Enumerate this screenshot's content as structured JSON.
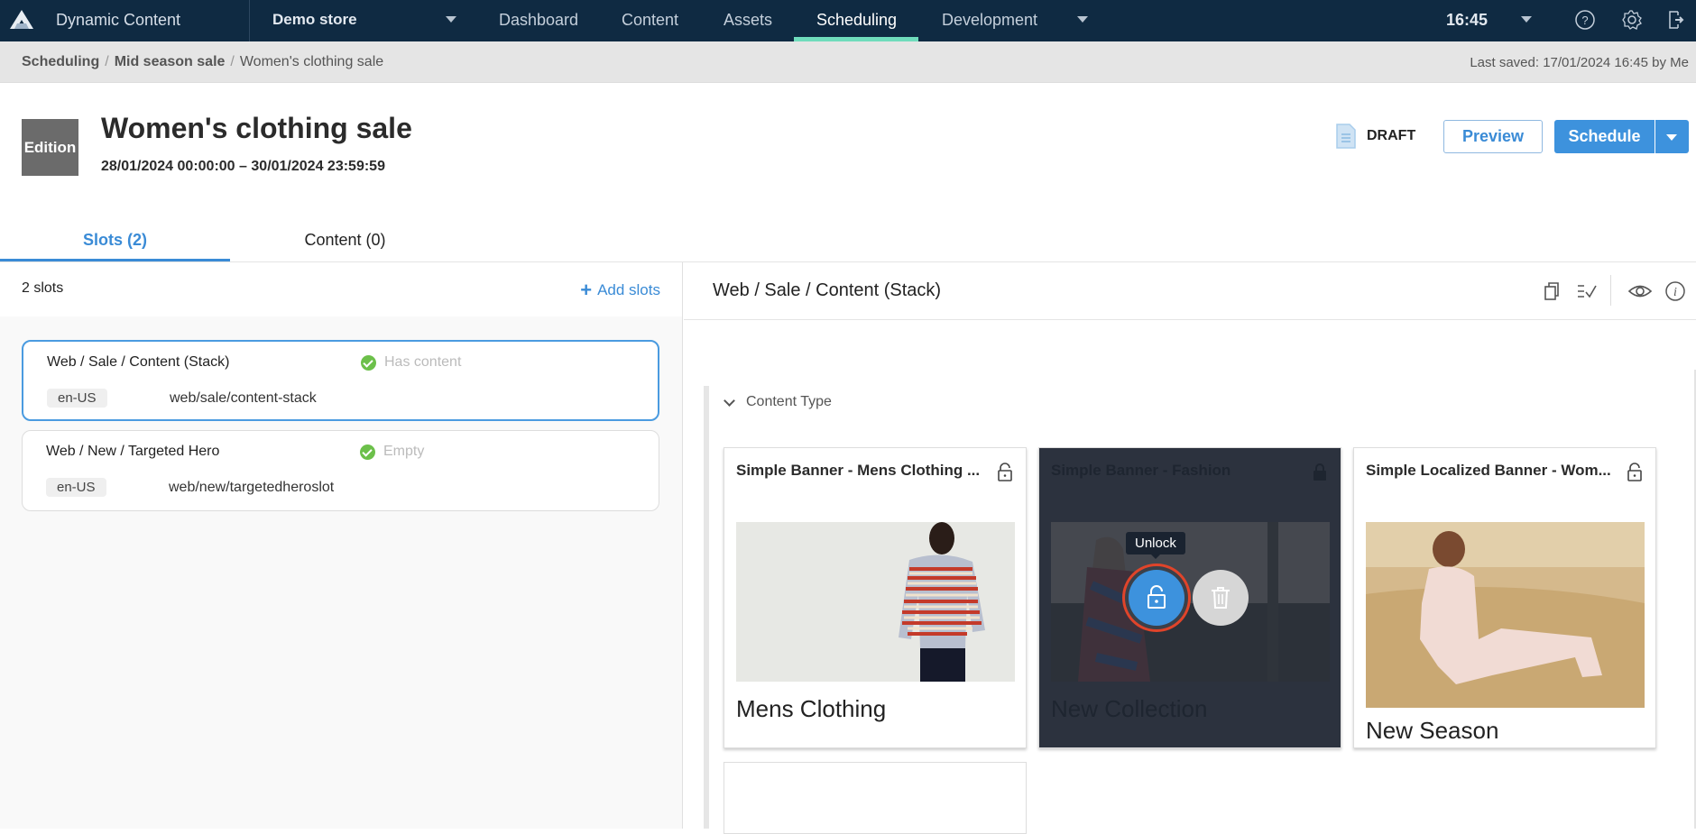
{
  "topbar": {
    "app_title": "Dynamic Content",
    "store": "Demo store",
    "nav": [
      {
        "label": "Dashboard",
        "active": false
      },
      {
        "label": "Content",
        "active": false
      },
      {
        "label": "Assets",
        "active": false
      },
      {
        "label": "Scheduling",
        "active": true
      },
      {
        "label": "Development",
        "active": false
      }
    ],
    "clock": "16:45",
    "icons": [
      "help-icon",
      "settings-icon",
      "logout-icon"
    ],
    "accent_color": "#6fdcbc"
  },
  "breadcrumb": {
    "items": [
      "Scheduling",
      "Mid season sale",
      "Women's clothing sale"
    ],
    "last_saved": "Last saved: 17/01/2024 16:45 by Me"
  },
  "header": {
    "badge": "Edition",
    "title": "Women's clothing sale",
    "date_start": "28/01/2024 00:00:00",
    "date_sep": "–",
    "date_end": "30/01/2024 23:59:59",
    "status": "DRAFT",
    "preview_label": "Preview",
    "schedule_label": "Schedule",
    "primary_color": "#3d92dd"
  },
  "tabs": [
    {
      "label": "Slots (2)",
      "active": true
    },
    {
      "label": "Content (0)",
      "active": false
    }
  ],
  "slots_panel": {
    "count_label": "2 slots",
    "add_label": "Add slots",
    "slots": [
      {
        "name": "Web / Sale / Content (Stack)",
        "status": "Has content",
        "locale": "en-US",
        "key": "web/sale/content-stack",
        "selected": true
      },
      {
        "name": "Web / New / Targeted Hero",
        "status": "Empty",
        "locale": "en-US",
        "key": "web/new/targetedheroslot",
        "selected": false
      }
    ]
  },
  "editor": {
    "title": "Web / Sale / Content (Stack)",
    "toolbar_icons": [
      "copy-icon",
      "validate-icon",
      "preview-icon",
      "info-icon"
    ],
    "section_label": "Content Type",
    "cards": [
      {
        "title": "Simple Banner - Mens Clothing ...",
        "caption": "Mens Clothing",
        "locked": false,
        "dimmed": false
      },
      {
        "title": "Simple Banner - Fashion",
        "caption": "New Collection",
        "locked": true,
        "dimmed": true
      },
      {
        "title": "Simple Localized Banner - Wom...",
        "caption": "New Season",
        "locked": false,
        "dimmed": false
      }
    ],
    "tooltip": "Unlock",
    "highlight_color": "#e0442a"
  }
}
